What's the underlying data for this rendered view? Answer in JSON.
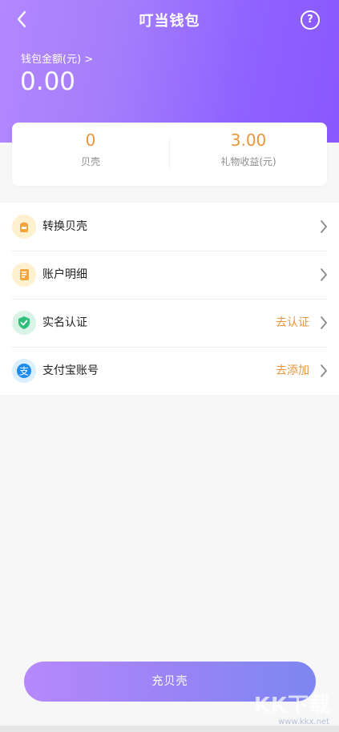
{
  "header": {
    "title": "叮当钱包",
    "back_icon": "chevron-left-icon",
    "help_label": "?",
    "wallet_label": "钱包金额(元) >",
    "wallet_amount": "0.00"
  },
  "stats": {
    "shells": {
      "value": "0",
      "label": "贝壳"
    },
    "gift_income": {
      "value": "3.00",
      "label": "礼物收益(元)"
    }
  },
  "menu": [
    {
      "label": "转换贝壳",
      "action": "",
      "icon": "convert-shells-icon"
    },
    {
      "label": "账户明细",
      "action": "",
      "icon": "account-details-icon"
    },
    {
      "label": "实名认证",
      "action": "去认证",
      "icon": "verified-shield-icon"
    },
    {
      "label": "支付宝账号",
      "action": "去添加",
      "icon": "alipay-icon"
    }
  ],
  "recharge_button": {
    "label": "充贝壳"
  },
  "watermark": {
    "text": "KK下载",
    "url": "www.kkx.net"
  },
  "colors": {
    "accent_orange": "#e8963a",
    "header_purple": "#9b6bff",
    "button_gradient_start": "#b688fb",
    "button_gradient_end": "#7d86f2"
  }
}
